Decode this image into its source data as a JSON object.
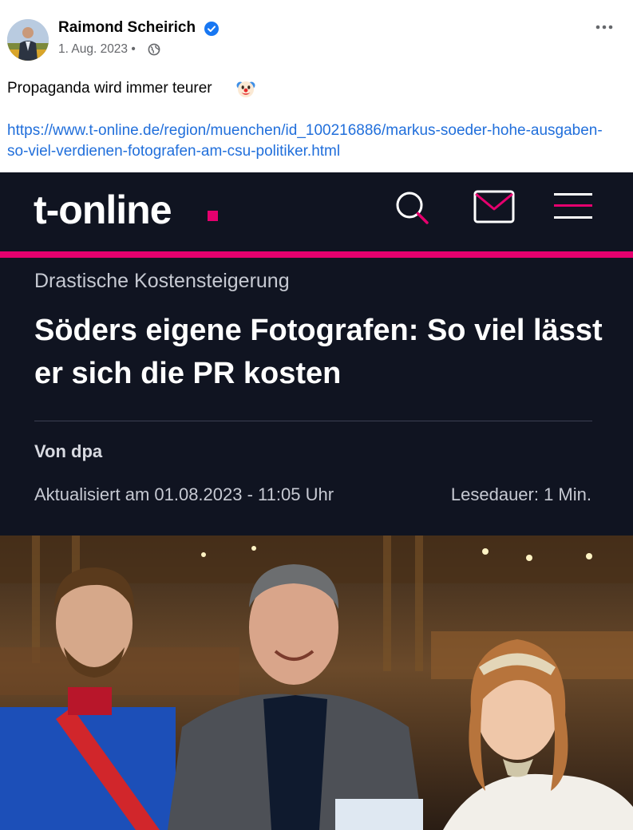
{
  "post": {
    "author": "Raimond Scheirich",
    "date": "1. Aug. 2023",
    "separator": "•",
    "text": "Propaganda wird immer teurer",
    "link": "https://www.t-online.de/region/muenchen/id_100216886/markus-soeder-hohe-ausgaben-so-viel-verdienen-fotografen-am-csu-politiker.html",
    "icons": {
      "verified": "verified-badge-icon",
      "audience": "globe-icon",
      "more": "more-options-icon",
      "emoji": "clown-face-emoji"
    },
    "colors": {
      "link": "#216fdb",
      "verified": "#1877f2",
      "meta": "#65676b"
    }
  },
  "shared_image": {
    "logo": "t-online",
    "kicker": "Drastische Kostensteigerung",
    "headline": "Söders eigene Fotografen: So viel lässt er sich die PR kosten",
    "byline": "Von dpa",
    "updated": "Aktualisiert am 01.08.2023 - 11:05 Uhr",
    "read_time": "Lesedauer: 1 Min.",
    "icons": {
      "search": "search-icon",
      "mail": "mail-icon",
      "menu": "hamburger-menu-icon"
    },
    "colors": {
      "background": "#101421",
      "accent": "#e5006e"
    }
  }
}
